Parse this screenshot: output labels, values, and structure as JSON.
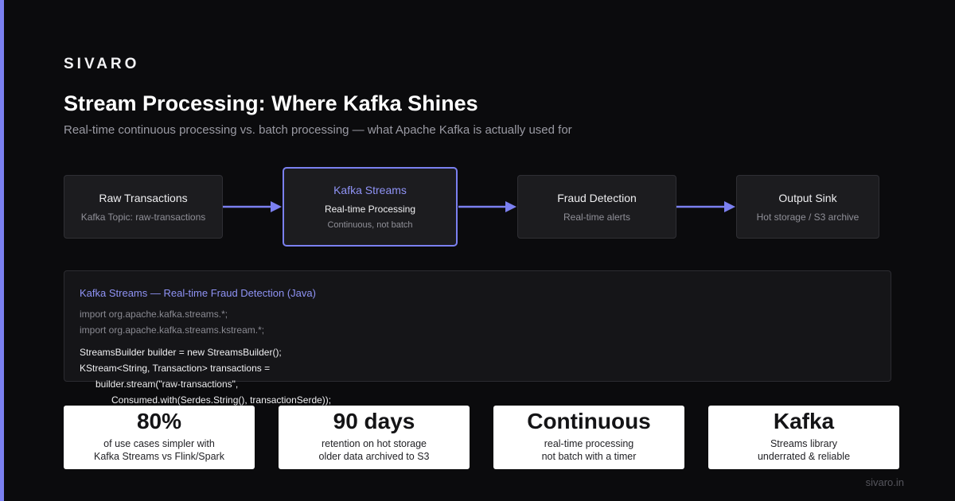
{
  "brand": "SIVARO",
  "title": "Stream Processing: Where Kafka Shines",
  "subtitle": "Real-time continuous processing vs. batch processing — what Apache Kafka is actually used for",
  "colors": {
    "accent": "#7b80f0",
    "background": "#0b0b0d",
    "node": "#1c1c1f"
  },
  "pipeline": [
    {
      "title": "Raw Transactions",
      "sub": "Kafka Topic: raw-transactions"
    },
    {
      "title": "Kafka Streams",
      "sub": "Real-time Processing",
      "sub2": "Continuous, not batch",
      "highlight": true
    },
    {
      "title": "Fraud Detection",
      "sub": "Real-time alerts"
    },
    {
      "title": "Output Sink",
      "sub": "Hot storage / S3 archive"
    }
  ],
  "code": {
    "title": "Kafka Streams — Real-time Fraud Detection (Java)",
    "lines": [
      "import org.apache.kafka.streams.*;",
      "import org.apache.kafka.streams.kstream.*;",
      "StreamsBuilder builder = new StreamsBuilder();",
      "KStream<String, Transaction> transactions =",
      "builder.stream(\"raw-transactions\",",
      "Consumed.with(Serdes.String(), transactionSerde));"
    ]
  },
  "stats": [
    {
      "value": "80%",
      "line1": "of use cases simpler with",
      "line2": "Kafka Streams vs Flink/Spark"
    },
    {
      "value": "90 days",
      "line1": "retention on hot storage",
      "line2": "older data archived to S3"
    },
    {
      "value": "Continuous",
      "line1": "real-time processing",
      "line2": "not batch with a timer"
    },
    {
      "value": "Kafka",
      "line1": "Streams library",
      "line2": "underrated & reliable"
    }
  ],
  "footer": "sivaro.in"
}
